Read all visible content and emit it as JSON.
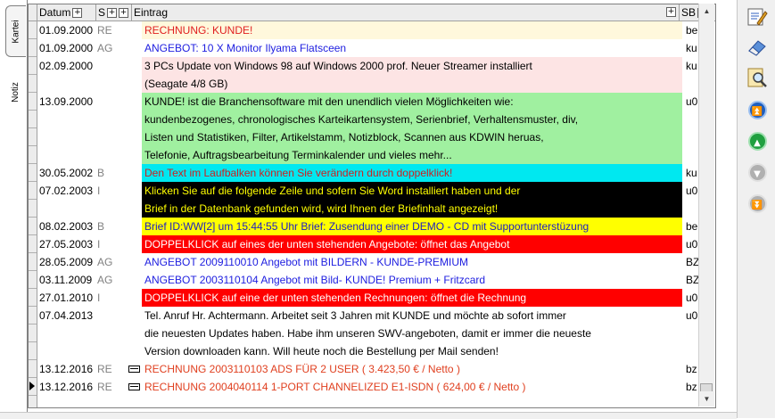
{
  "tabs": {
    "kartei": "Kartei",
    "notiz": "Notiz"
  },
  "columns": {
    "datum": "Datum",
    "s": "S",
    "eintrag": "Eintrag",
    "sb": "SB",
    "expand": "+"
  },
  "rows": [
    {
      "date": "01.09.2000",
      "s": "RE",
      "text": "RECHNUNG: KUNDE!",
      "sb": "ber",
      "bg": "#fff8dc",
      "fg": "#e02020",
      "mail": false
    },
    {
      "date": "01.09.2000",
      "s": "AG",
      "text": "ANGEBOT: 10 X Monitor Ilyama Flatsceen",
      "sb": "ku",
      "bg": "#ffffff",
      "fg": "#2020e0",
      "mail": false
    },
    {
      "date": "02.09.2000",
      "s": "",
      "text": "3 PCs Update von Windows 98 auf Windows 2000 prof. Neuer Streamer installiert",
      "sb": "ku",
      "bg": "#fde4e4",
      "fg": "#000000",
      "mail": false
    },
    {
      "date": "",
      "s": "",
      "text": "(Seagate 4/8 GB)",
      "sb": "",
      "bg": "#fde4e4",
      "fg": "#000000",
      "mail": false
    },
    {
      "date": "13.09.2000",
      "s": "",
      "text": "KUNDE! ist die Branchensoftware mit den unendlich vielen Möglichkeiten wie:",
      "sb": "u0",
      "bg": "#a0f0a0",
      "fg": "#000000",
      "mail": false
    },
    {
      "date": "",
      "s": "",
      "text": "kundenbezogenes, chronologisches Karteikartensystem, Serienbrief, Verhaltensmuster, div,",
      "sb": "",
      "bg": "#a0f0a0",
      "fg": "#000000",
      "mail": false
    },
    {
      "date": "",
      "s": "",
      "text": "Listen und Statistiken, Filter, Artikelstamm, Notizblock, Scannen aus KDWIN heruas,",
      "sb": "",
      "bg": "#a0f0a0",
      "fg": "#000000",
      "mail": false
    },
    {
      "date": "",
      "s": "",
      "text": "Telefonie, Auftragsbearbeitung Terminkalender und vieles mehr...",
      "sb": "",
      "bg": "#a0f0a0",
      "fg": "#000000",
      "mail": false
    },
    {
      "date": "30.05.2002",
      "s": "B",
      "text": "Den Text im Laufbalken können Sie verändern durch doppelklick!",
      "sb": "ku",
      "bg": "#00e8f0",
      "fg": "#d02020",
      "mail": false
    },
    {
      "date": "07.02.2003",
      "s": "I",
      "text": "Klicken Sie auf die folgende Zeile und sofern Sie Word installiert haben und der",
      "sb": "u0",
      "bg": "#000000",
      "fg": "#ffff00",
      "mail": false
    },
    {
      "date": "",
      "s": "",
      "text": "Brief in der Datenbank gefunden wird, wird Ihnen der Briefinhalt angezeigt!",
      "sb": "",
      "bg": "#000000",
      "fg": "#ffff00",
      "mail": false
    },
    {
      "date": "08.02.2003",
      "s": "B",
      "text": "Brief ID:WW[2] um 15:44:55 Uhr Brief: Zusendung einer DEMO - CD mit Supportunterstüzung",
      "sb": "be",
      "bg": "#ffff00",
      "fg": "#2020c0",
      "mail": false
    },
    {
      "date": "27.05.2003",
      "s": "I",
      "text": "DOPPELKLICK auf eines der unten stehenden Angebote: öffnet das Angebot",
      "sb": "u0",
      "bg": "#ff0000",
      "fg": "#ffffff",
      "mail": false
    },
    {
      "date": "28.05.2009",
      "s": "AG",
      "text": "ANGEBOT 2009110010 Angebot mit BILDERN - KUNDE-PREMIUM",
      "sb": "BZ",
      "bg": "#ffffff",
      "fg": "#2020e0",
      "mail": false
    },
    {
      "date": "03.11.2009",
      "s": "AG",
      "text": "ANGEBOT 2003110104 Angebot mit Bild- KUNDE! Premium + Fritzcard",
      "sb": "BZ",
      "bg": "#ffffff",
      "fg": "#2020e0",
      "mail": false
    },
    {
      "date": "27.01.2010",
      "s": "I",
      "text": "DOPPELKLICK auf eine der unten stehenden Rechnungen: öffnet die Rechnung",
      "sb": "u0",
      "bg": "#ff0000",
      "fg": "#ffffff",
      "mail": false
    },
    {
      "date": "07.04.2013",
      "s": "",
      "text": "Tel. Anruf Hr. Achtermann. Arbeitet seit 3 Jahren mit KUNDE und möchte ab sofort immer",
      "sb": "u0",
      "bg": "#ffffff",
      "fg": "#000000",
      "mail": false
    },
    {
      "date": "",
      "s": "",
      "text": "die neuesten Updates haben. Habe ihm unseren SWV-angeboten, damit er immer die neueste",
      "sb": "",
      "bg": "#ffffff",
      "fg": "#000000",
      "mail": false
    },
    {
      "date": "",
      "s": "",
      "text": "Version downloaden kann. Will heute noch die Bestellung per Mail senden!",
      "sb": "",
      "bg": "#ffffff",
      "fg": "#000000",
      "mail": false
    },
    {
      "date": "13.12.2016",
      "s": "RE",
      "text": "RECHNUNG 2003110103 ADS FÜR 2 USER ( 3.423,50 € / Netto )",
      "sb": "bz",
      "bg": "#ffffff",
      "fg": "#e04020",
      "mail": true
    },
    {
      "date": "13.12.2016",
      "s": "RE",
      "text": "RECHNUNG 2004040114 1-PORT CHANNELIZED E1-ISDN (   624,00 € / Netto )",
      "sb": "bz",
      "bg": "#ffffff",
      "fg": "#e04020",
      "mail": true
    }
  ],
  "toolbar": [
    {
      "name": "edit-note-icon"
    },
    {
      "name": "eraser-icon"
    },
    {
      "name": "search-document-icon"
    },
    {
      "name": "first-record-icon",
      "color": "#1e5fc0",
      "glyph": "⏫"
    },
    {
      "name": "previous-record-icon",
      "color": "#20a040",
      "glyph": "▲"
    },
    {
      "name": "next-record-icon",
      "color": "#b0b0b0",
      "glyph": "▼"
    },
    {
      "name": "last-record-icon",
      "color": "#b0b0b0",
      "glyph": "⏬"
    }
  ],
  "scrollbar": {
    "up": "▲",
    "down": "▼"
  }
}
